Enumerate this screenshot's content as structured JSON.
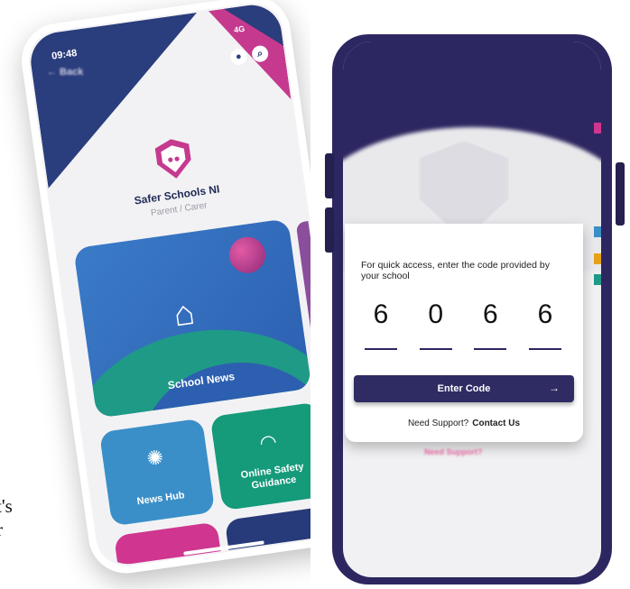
{
  "caption_fragment": [
    "t's",
    "r"
  ],
  "left_phone": {
    "time": "09:48",
    "network": "4G",
    "app_name": "Safer Schools NI",
    "role": "Parent / Carer",
    "tiles": {
      "school_news": "School News",
      "news_hub": "News Hub",
      "online_safety": "Online Safety Guidance"
    },
    "icons": [
      "profile-icon",
      "search-icon",
      "house-icon",
      "lightbulb-icon",
      "wifi-icon"
    ],
    "colors": {
      "navy": "#2a3d7c",
      "pink": "#c53a8e",
      "blue": "#3a7bc8",
      "teal": "#159a7a"
    }
  },
  "right_phone": {
    "back_label": "← Back",
    "prompt": "For quick access, enter the code provided by your school",
    "code_digits": [
      "6",
      "0",
      "6",
      "6"
    ],
    "enter_button": "Enter Code",
    "enter_arrow": "→",
    "support_text": "Need Support?",
    "contact_link": "Contact Us",
    "background_support": "Need Support?",
    "colors": {
      "frame": "#2d2761",
      "button": "#2f2b63"
    }
  }
}
